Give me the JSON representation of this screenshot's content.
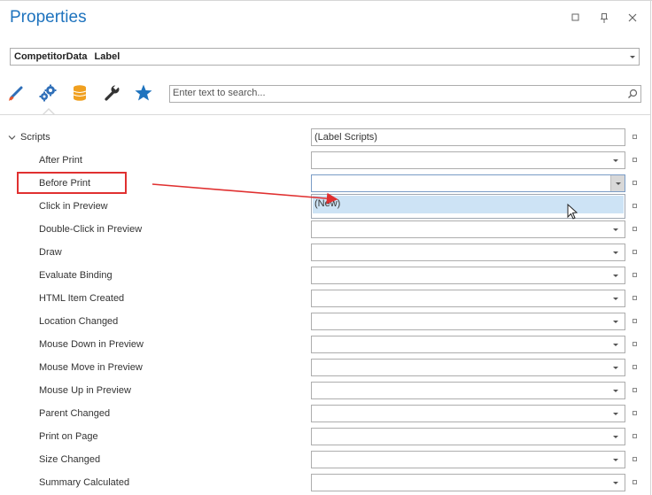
{
  "panel": {
    "title": "Properties",
    "window_buttons": [
      {
        "name": "restore",
        "glyph": "□"
      },
      {
        "name": "pin",
        "glyph": "⊥"
      },
      {
        "name": "close",
        "glyph": "✕"
      }
    ]
  },
  "selector": {
    "object_name": "CompetitorData",
    "object_type": "Label"
  },
  "tabs": [
    {
      "name": "appearance",
      "icon": "brush-icon",
      "active": false
    },
    {
      "name": "behavior",
      "icon": "gears-icon",
      "active": true
    },
    {
      "name": "data",
      "icon": "database-icon",
      "active": false
    },
    {
      "name": "tools",
      "icon": "wrench-icon",
      "active": false
    },
    {
      "name": "favorites",
      "icon": "star-icon",
      "active": false
    }
  ],
  "search": {
    "placeholder": "Enter text to search..."
  },
  "category": {
    "label": "Scripts",
    "value": "(Label Scripts)"
  },
  "rows": [
    {
      "label": "After Print"
    },
    {
      "label": "Before Print",
      "active": true
    },
    {
      "label": "Click in Preview"
    },
    {
      "label": "Double-Click in Preview"
    },
    {
      "label": "Draw"
    },
    {
      "label": "Evaluate Binding"
    },
    {
      "label": "HTML Item Created"
    },
    {
      "label": "Location Changed"
    },
    {
      "label": "Mouse Down in Preview"
    },
    {
      "label": "Mouse Move in Preview"
    },
    {
      "label": "Mouse Up in Preview"
    },
    {
      "label": "Parent Changed"
    },
    {
      "label": "Print on Page"
    },
    {
      "label": "Size Changed"
    },
    {
      "label": "Summary Calculated"
    }
  ],
  "dropdown": {
    "options": [
      "(New)"
    ]
  },
  "colors": {
    "title": "#1e73be",
    "annotation": "#e03030",
    "selected_option": "#cde3f5"
  }
}
